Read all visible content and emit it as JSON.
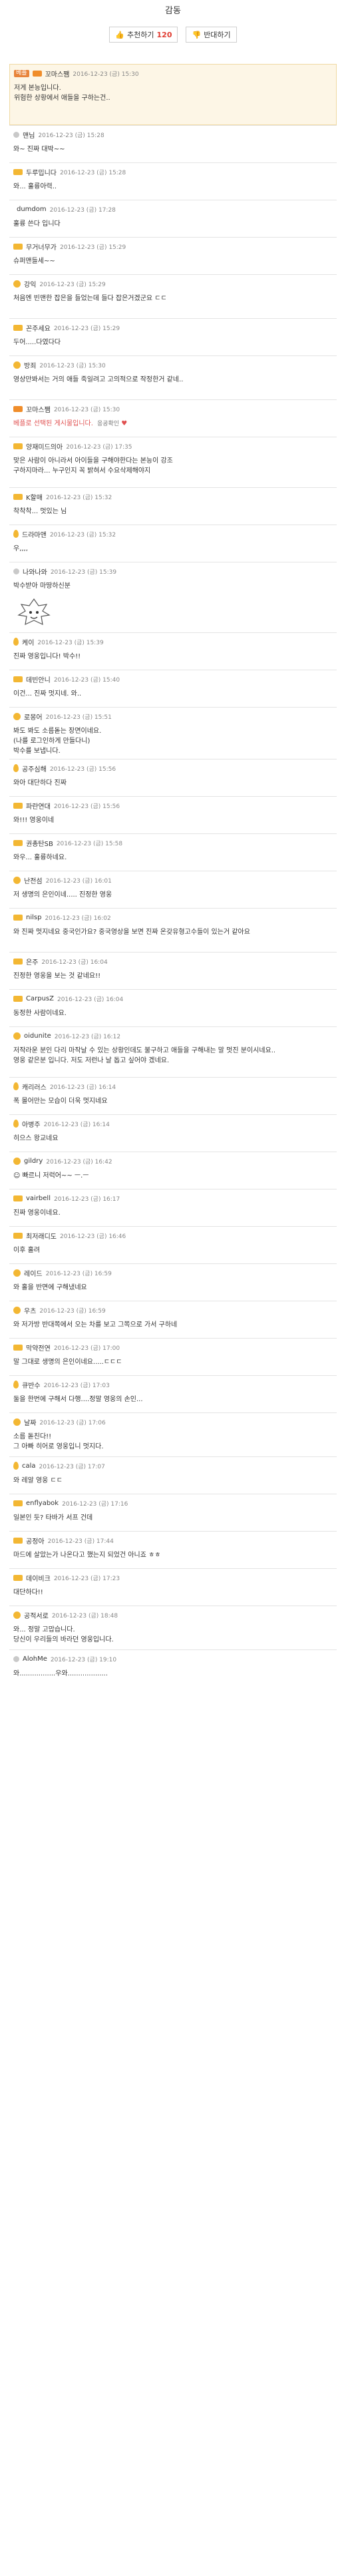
{
  "title": "감동",
  "votes": {
    "up_label": "추천하기",
    "up_count": "120",
    "down_label": "반대하기"
  },
  "comments": [
    {
      "h": 92,
      "best": true,
      "badge": "베플",
      "lv": "orange",
      "nick": "꼬마스쨈",
      "date": "2016-12-23 (금) 15:30",
      "lines": [
        "저게 본능입니다.",
        "위험한 상황에서 애들을 구하는건.."
      ]
    },
    {
      "h": 56,
      "lv": "gray",
      "nick": "맨님",
      "date": "2016-12-23 (금) 15:28",
      "lines": [
        "와~ 진짜 대박~~"
      ]
    },
    {
      "h": 56,
      "lv": "normal",
      "nick": "두루밉니다",
      "date": "2016-12-23 (금) 15:28",
      "lines": [
        "와... 훌륭아력.."
      ]
    },
    {
      "h": 56,
      "lv": "none",
      "nick": "dumdom",
      "date": "2016-12-23 (금) 17:28",
      "lines": [
        "훌륭 쓴다 입니다"
      ]
    },
    {
      "h": 56,
      "lv": "normal",
      "nick": "무거너무가",
      "date": "2016-12-23 (금) 15:29",
      "lines": [
        "슈퍼맨들세~~"
      ]
    },
    {
      "h": 66,
      "lv": "dot",
      "nick": "강익",
      "date": "2016-12-23 (금) 15:29",
      "lines": [
        "처음엔 빈맨한 잡은을 들었는데 들다 잡은거겠군요 ㄷㄷ"
      ]
    },
    {
      "h": 56,
      "lv": "normal",
      "nick": "꼰주세요",
      "date": "2016-12-23 (금) 15:29",
      "lines": [
        "두어.....다였다다"
      ]
    },
    {
      "h": 66,
      "lv": "dot",
      "nick": "방죄",
      "date": "2016-12-23 (금) 15:30",
      "lines": [
        "영상만봐서는 거의 애들 죽일려고 고의적으로 작정한거 같네.."
      ]
    },
    {
      "h": 56,
      "lv": "orange",
      "nick": "꼬마스쨈",
      "date": "2016-12-23 (금) 15:30",
      "blind": "베플로 선택된 게시물입니다.",
      "fav": "응공확인",
      "lines": []
    },
    {
      "h": 76,
      "lv": "normal",
      "nick": "양재미드의아",
      "date": "2016-12-23 (금) 17:35",
      "lines": [
        "맞은 사람이 아니라서 아이들을 구해야한다는 본능이 강조",
        "구하지마라... 누구인지 꼭 밝혀서 수요삭제해야지"
      ]
    },
    {
      "h": 56,
      "lv": "normal",
      "nick": "K할매",
      "date": "2016-12-23 (금) 15:32",
      "lines": [
        "착착착... 멋있는 님"
      ]
    },
    {
      "h": 56,
      "lv": "drop",
      "nick": "드라마앤",
      "date": "2016-12-23 (금) 15:32",
      "lines": [
        "우,,,,"
      ]
    },
    {
      "h": 106,
      "lv": "gray",
      "nick": "나와나와",
      "date": "2016-12-23 (금) 15:39",
      "lines": [
        "박수받아 마땅하신분"
      ],
      "emo": true
    },
    {
      "h": 56,
      "lv": "drop",
      "nick": "케이",
      "date": "2016-12-23 (금) 15:39",
      "lines": [
        "진짜 영웅입니다! 박수!!"
      ]
    },
    {
      "h": 56,
      "lv": "normal",
      "nick": "데빈안니",
      "date": "2016-12-23 (금) 15:40",
      "lines": [
        "이건... 진짜 멋지네. 와.."
      ]
    },
    {
      "h": 78,
      "lv": "dot",
      "nick": "로몽어",
      "date": "2016-12-23 (금) 15:51",
      "lines": [
        "봐도 봐도 소름돋는 장면이네요.",
        "(나를 로그인하게 만들다니)",
        "박수를 보냅니다."
      ]
    },
    {
      "h": 56,
      "lv": "drop",
      "nick": "공주심해",
      "date": "2016-12-23 (금) 15:56",
      "lines": [
        "와아 대단하다 진짜"
      ]
    },
    {
      "h": 56,
      "lv": "normal",
      "nick": "파란연대",
      "date": "2016-12-23 (금) 15:56",
      "lines": [
        "와!!! 영웅이네"
      ]
    },
    {
      "h": 56,
      "lv": "normal",
      "nick": "권총탄SB",
      "date": "2016-12-23 (금) 15:58",
      "lines": [
        "와우... 훌륭하네요."
      ]
    },
    {
      "h": 56,
      "lv": "dot",
      "nick": "난전섬",
      "date": "2016-12-23 (금) 16:01",
      "lines": [
        "저 생명의 은인이네..... 진정한 영웅"
      ]
    },
    {
      "h": 66,
      "lv": "normal",
      "nick": "nilsp",
      "date": "2016-12-23 (금) 16:02",
      "lines": [
        "와 진짜 멋지네요 중국인가요? 중국영상을 보면 진짜 온갖유형고수들이 있는거 같아요"
      ]
    },
    {
      "h": 56,
      "lv": "normal",
      "nick": "은주",
      "date": "2016-12-23 (금) 16:04",
      "lines": [
        "진정한 영웅을 보는 것 같네요!!"
      ]
    },
    {
      "h": 56,
      "lv": "normal",
      "nick": "CarpusZ",
      "date": "2016-12-23 (금) 16:04",
      "lines": [
        "동정한 사람이네요."
      ]
    },
    {
      "h": 76,
      "lv": "dot",
      "nick": "oidunite",
      "date": "2016-12-23 (금) 16:12",
      "lines": [
        "저작라운 분인 다리 마작날 수 있는 상황인데도 불구하고 애들을 구해내는 말 멋진 분이시네요..",
        "영웅 같은분 입니다. 저도 저런나 날 돕고 싶어야 겠네요."
      ]
    },
    {
      "h": 56,
      "lv": "drop",
      "nick": "캐리러스",
      "date": "2016-12-23 (금) 16:14",
      "lines": [
        "폭 몰어만는 모습이 더욱 멋지네요"
      ]
    },
    {
      "h": 56,
      "lv": "drop",
      "nick": "아병주",
      "date": "2016-12-23 (금) 16:14",
      "lines": [
        "히으스 왕교네요"
      ]
    },
    {
      "h": 56,
      "lv": "dot",
      "nick": "gildry",
      "date": "2016-12-23 (금) 16:42",
      "lines": [
        "☺ 빠르니 저럭어~~ ㅡ.ㅡ"
      ]
    },
    {
      "h": 56,
      "lv": "normal",
      "nick": "vairbell",
      "date": "2016-12-23 (금) 16:17",
      "lines": [
        "진짜 영웅이네요."
      ]
    },
    {
      "h": 56,
      "lv": "normal",
      "nick": "최저래디도",
      "date": "2016-12-23 (금) 16:46",
      "lines": [
        "이후 홀려"
      ]
    },
    {
      "h": 56,
      "lv": "dot",
      "nick": "레이드",
      "date": "2016-12-23 (금) 16:59",
      "lines": [
        "와 홀을 반면에 구해냈네요"
      ]
    },
    {
      "h": 56,
      "lv": "dot",
      "nick": "우츠",
      "date": "2016-12-23 (금) 16:59",
      "lines": [
        "와 저가방 반대쪽에서 오는 차를 보고 그쪽으로 가서 구하네"
      ]
    },
    {
      "h": 56,
      "lv": "normal",
      "nick": "막약전연",
      "date": "2016-12-23 (금) 17:00",
      "lines": [
        "말 그대로 생명의 은인이네요.....ㄷㄷㄷ"
      ]
    },
    {
      "h": 56,
      "lv": "drop",
      "nick": "큐반수",
      "date": "2016-12-23 (금) 17:03",
      "lines": [
        "둘을 한번에 구해서 다행....정말 영웅의 손인..."
      ]
    },
    {
      "h": 66,
      "lv": "dot",
      "nick": "날짜",
      "date": "2016-12-23 (금) 17:06",
      "lines": [
        "소름 돋친다!!",
        "그 아빠 히어로 영웅입니 멋지다."
      ]
    },
    {
      "h": 56,
      "lv": "drop",
      "nick": "cala",
      "date": "2016-12-23 (금) 17:07",
      "lines": [
        "와 레알 영웅 ㄷㄷ"
      ]
    },
    {
      "h": 56,
      "lv": "normal",
      "nick": "enflyabok",
      "date": "2016-12-23 (금) 17:16",
      "lines": [
        "일본인 듯? 타바가 서프 건데"
      ]
    },
    {
      "h": 56,
      "lv": "normal",
      "nick": "공정아",
      "date": "2016-12-23 (금) 17:44",
      "lines": [
        "마드에 살았는가 나온다고 했는지 되었건 아니죠 ㅎㅎ"
      ]
    },
    {
      "h": 56,
      "lv": "normal",
      "nick": "데이비크",
      "date": "2016-12-23 (금) 17:23",
      "lines": [
        "대단하다!!"
      ]
    },
    {
      "h": 66,
      "lv": "dot",
      "nick": "공적서로",
      "date": "2016-12-23 (금) 18:48",
      "lines": [
        "와... 정말 고맙습니다.",
        "당신이 우리들의 바라던 영웅입니다."
      ]
    },
    {
      "h": 46,
      "lv": "gray",
      "nick": "AlohMe",
      "date": "2016-12-23 (금) 19:10",
      "lines": [
        "와.................우와..................."
      ]
    }
  ]
}
